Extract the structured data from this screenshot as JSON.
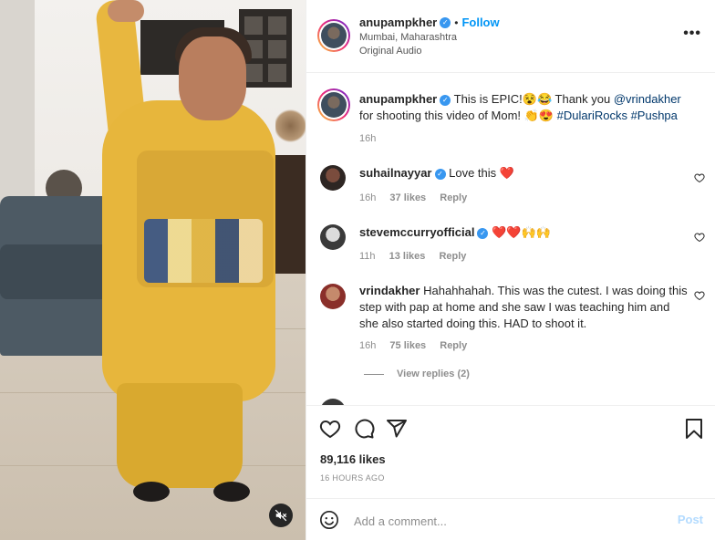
{
  "header": {
    "username": "anupampkher",
    "follow_label": "Follow",
    "location": "Mumbai, Maharashtra",
    "audio": "Original Audio"
  },
  "caption": {
    "username": "anupampkher",
    "text_1": "This is EPIC!",
    "emoji_1": "😵😂",
    "text_2": "Thank you",
    "mention": "@vrindakher",
    "text_3": "for shooting this video of Mom!",
    "emoji_2": "👏😍",
    "hashtags": "#DulariRocks #Pushpa",
    "time": "16h"
  },
  "comments": [
    {
      "username": "suhailnayyar",
      "verified": true,
      "text": "Love this",
      "emoji": "❤️",
      "time": "16h",
      "likes": "37 likes",
      "reply": "Reply"
    },
    {
      "username": "stevemccurryofficial",
      "verified": true,
      "text": "",
      "emoji": "❤️❤️🙌🙌",
      "time": "11h",
      "likes": "13 likes",
      "reply": "Reply"
    },
    {
      "username": "vrindakher",
      "verified": false,
      "text": "Hahahhahah. This was the cutest. I was doing this step with pap at home and she saw I was teaching him and she also started doing this. HAD to shoot it.",
      "emoji": "",
      "time": "16h",
      "likes": "75 likes",
      "reply": "Reply",
      "view_replies": "View replies (2)"
    }
  ],
  "stats": {
    "likes": "89,116 likes",
    "time_ago": "16 HOURS AGO"
  },
  "add_comment": {
    "placeholder": "Add a comment...",
    "post_label": "Post"
  },
  "icons": {
    "more": "more-options-icon",
    "like": "heart-icon",
    "comment": "comment-icon",
    "share": "share-icon",
    "save": "bookmark-icon",
    "emoji": "emoji-icon",
    "mute": "muted-speaker-icon"
  },
  "colors": {
    "follow": "#0095f6",
    "link": "#00376b",
    "verified": "#3897f0",
    "muted_text": "#8e8e8e"
  }
}
